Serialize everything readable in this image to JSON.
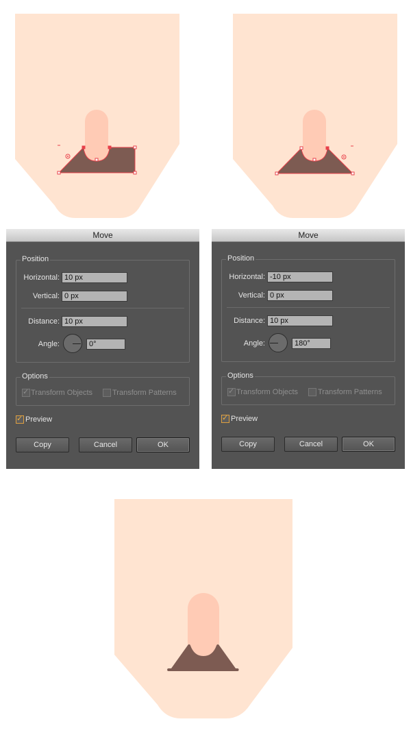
{
  "dialogs": [
    {
      "title": "Move",
      "position_label": "Position",
      "horizontal_label": "Horizontal:",
      "horizontal_value": "10 px",
      "vertical_label": "Vertical:",
      "vertical_value": "0 px",
      "distance_label": "Distance:",
      "distance_value": "10 px",
      "angle_label": "Angle:",
      "angle_value": "0°",
      "options_label": "Options",
      "transform_objects_label": "Transform Objects",
      "transform_patterns_label": "Transform Patterns",
      "preview_label": "Preview",
      "copy_label": "Copy",
      "cancel_label": "Cancel",
      "ok_label": "OK"
    },
    {
      "title": "Move",
      "position_label": "Position",
      "horizontal_label": "Horizontal:",
      "horizontal_value": "-10 px",
      "vertical_label": "Vertical:",
      "vertical_value": "0 px",
      "distance_label": "Distance:",
      "distance_value": "10 px",
      "angle_label": "Angle:",
      "angle_value": "180°",
      "options_label": "Options",
      "transform_objects_label": "Transform Objects",
      "transform_patterns_label": "Transform Patterns",
      "preview_label": "Preview",
      "copy_label": "Copy",
      "cancel_label": "Cancel",
      "ok_label": "OK"
    }
  ],
  "colors": {
    "skin": "#ffe4d1",
    "finger": "#ffcbb5",
    "shape": "#7d5b52",
    "selection": "#e8404a",
    "dialog_bg": "#535353"
  }
}
